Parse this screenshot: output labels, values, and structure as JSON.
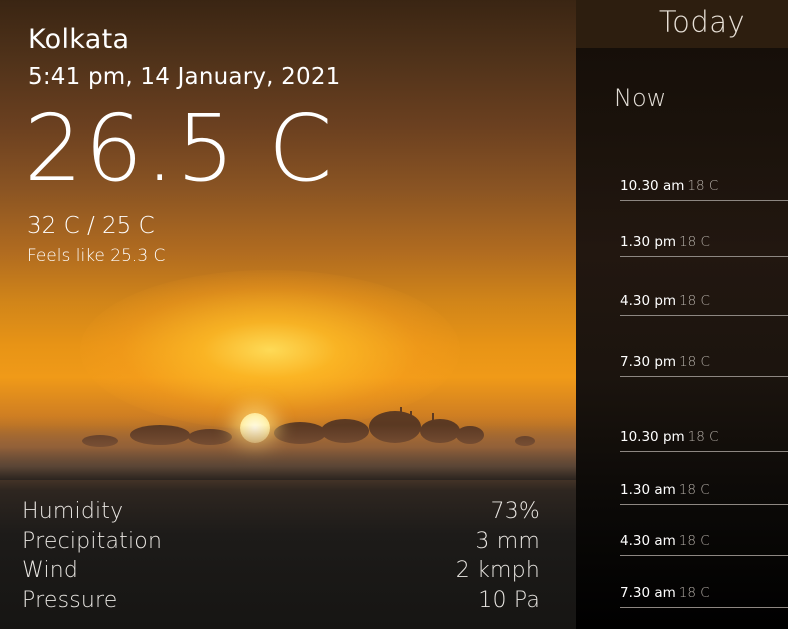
{
  "location": {
    "city": "Kolkata",
    "datetime": "5:41 pm, 14 January, 2021"
  },
  "current": {
    "temperature": "26.5 C",
    "range": "32 C / 25 C",
    "feels_like": "Feels like 25.3 C"
  },
  "details": [
    {
      "label": "Humidity",
      "value": "73%"
    },
    {
      "label": "Precipitation",
      "value": "3 mm"
    },
    {
      "label": "Wind",
      "value": "2 kmph"
    },
    {
      "label": "Pressure",
      "value": "10 Pa"
    }
  ],
  "forecast": {
    "header": "Today",
    "now_label": "Now",
    "items": [
      {
        "time": "10.30 am",
        "temp": "18 C"
      },
      {
        "time": "1.30 pm",
        "temp": "18 C"
      },
      {
        "time": "4.30 pm",
        "temp": "18 C"
      },
      {
        "time": "7.30 pm",
        "temp": "18 C"
      },
      {
        "time": "10.30 pm",
        "temp": "18 C"
      },
      {
        "time": "1.30 am",
        "temp": "18 C"
      },
      {
        "time": "4.30 am",
        "temp": "18 C"
      },
      {
        "time": "7.30 am",
        "temp": "18 C"
      }
    ]
  }
}
